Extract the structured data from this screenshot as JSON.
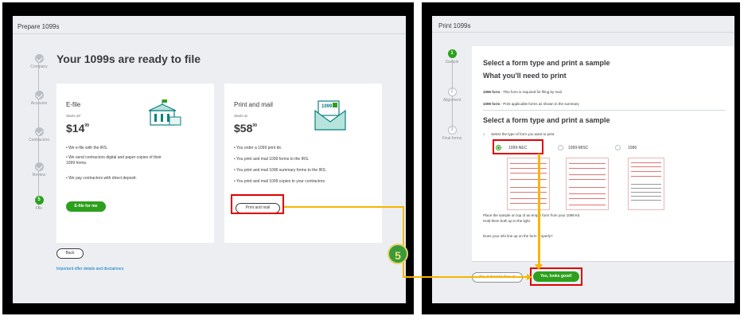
{
  "left": {
    "header": "Prepare 1099s",
    "title": "Your 1099s are ready to file",
    "steps": [
      "Company",
      "Accounts",
      "Contractors",
      "Review",
      "File"
    ],
    "step_active_number": "5",
    "efile": {
      "title": "E-file",
      "starts_at": "Starts at*",
      "price": "$14",
      "price_cents": "99",
      "bullets": [
        "• We e-file with the IRS.",
        "• We send contractors digital and paper copies of their",
        "   1099 forms.",
        "• We pay contractors with direct deposit."
      ],
      "button": "E-file for me"
    },
    "print": {
      "title": "Print and mail",
      "starts_at": "Starts at",
      "price": "$58",
      "price_cents": "99",
      "bullets": [
        "• You order a 1099 print kit.",
        "• You print and mail 1099 forms to the IRS.",
        "• You print and mail 1096 summary forms to the IRS.",
        "• You print and mail 1099 copies to your contractors."
      ],
      "button": "Print and mail"
    },
    "back_button": "Back",
    "disclaimer_link": "Important offer details and disclaimers"
  },
  "right": {
    "header": "Print 1099s",
    "steps": [
      {
        "num": "1",
        "label": "Sample"
      },
      {
        "num": "2",
        "label": "Alignment"
      },
      {
        "num": "3",
        "label": "Final forms"
      }
    ],
    "title1": "Select a form type and print a sample",
    "title2": "What you'll need to print",
    "need_1096": "1096 form",
    "need_1096_desc": " - This form is required for filing by mail",
    "need_1099": "1099 form",
    "need_1099_desc": " - Print applicable forms as shown in the summary",
    "title3": "Select a form type and print a sample",
    "instruction_num": "1",
    "instruction": "Select the type of form you want to print.",
    "options": [
      "1099-NEC",
      "1099-MISC",
      "1096"
    ],
    "place_text_1": "Place the sample on top of an empty form from your 1099 Kit.",
    "place_text_2": "Hold them both up to the light.",
    "question": "Does your info line up on the form properly?",
    "no_button": "No, it doesn't line up",
    "yes_button": "Yes, looks good!"
  },
  "callout": "5",
  "colors": {
    "green": "#2ca01c",
    "red": "#e00000",
    "connector": "#f7b500"
  }
}
